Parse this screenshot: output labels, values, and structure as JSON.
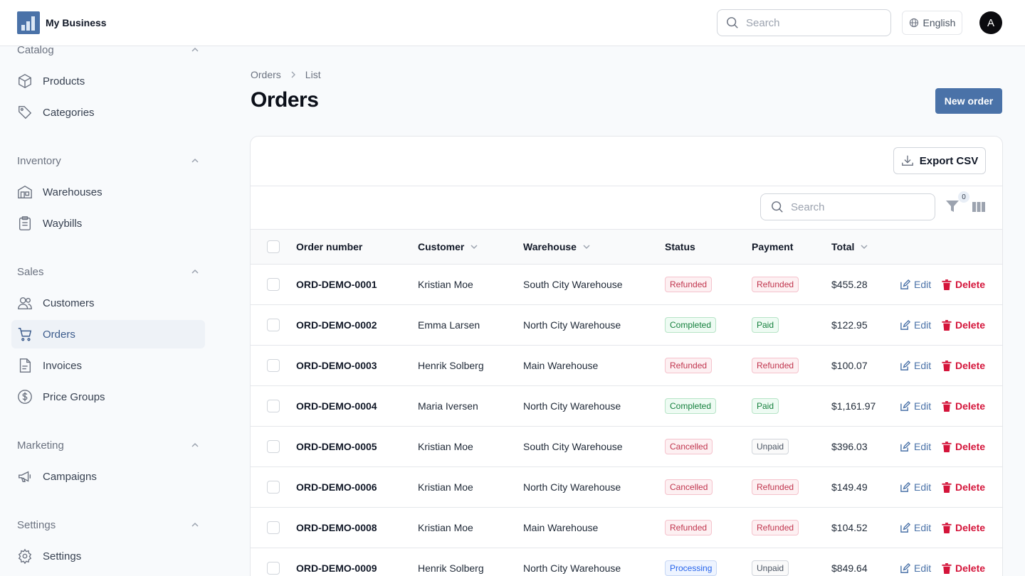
{
  "header": {
    "brand_name": "My Business",
    "search_placeholder": "Search",
    "language": "English",
    "avatar_initial": "A"
  },
  "sidebar": {
    "sections": [
      {
        "title": "Catalog",
        "items": [
          {
            "label": "Products",
            "icon": "box-icon"
          },
          {
            "label": "Categories",
            "icon": "tag-icon"
          }
        ]
      },
      {
        "title": "Inventory",
        "items": [
          {
            "label": "Warehouses",
            "icon": "warehouse-icon"
          },
          {
            "label": "Waybills",
            "icon": "clipboard-icon"
          }
        ]
      },
      {
        "title": "Sales",
        "items": [
          {
            "label": "Customers",
            "icon": "users-icon"
          },
          {
            "label": "Orders",
            "icon": "cart-icon"
          },
          {
            "label": "Invoices",
            "icon": "document-icon"
          },
          {
            "label": "Price Groups",
            "icon": "dollar-circle-icon"
          }
        ]
      },
      {
        "title": "Marketing",
        "items": [
          {
            "label": "Campaigns",
            "icon": "megaphone-icon"
          }
        ]
      },
      {
        "title": "Settings",
        "items": [
          {
            "label": "Settings",
            "icon": "gear-icon"
          }
        ]
      }
    ],
    "active_item": "Orders"
  },
  "breadcrumb": {
    "root": "Orders",
    "current": "List"
  },
  "page": {
    "title": "Orders",
    "new_button": "New order"
  },
  "toolbar": {
    "export_label": "Export CSV",
    "search_placeholder": "Search",
    "filter_count": "0"
  },
  "table": {
    "columns": {
      "order_number": "Order number",
      "customer": "Customer",
      "warehouse": "Warehouse",
      "status": "Status",
      "payment": "Payment",
      "total": "Total"
    },
    "actions": {
      "edit": "Edit",
      "delete": "Delete"
    },
    "rows": [
      {
        "number": "ORD-DEMO-0001",
        "customer": "Kristian Moe",
        "warehouse": "South City Warehouse",
        "status": "Refunded",
        "status_tone": "red",
        "payment": "Refunded",
        "payment_tone": "red",
        "total": "$455.28"
      },
      {
        "number": "ORD-DEMO-0002",
        "customer": "Emma Larsen",
        "warehouse": "North City Warehouse",
        "status": "Completed",
        "status_tone": "green",
        "payment": "Paid",
        "payment_tone": "green",
        "total": "$122.95"
      },
      {
        "number": "ORD-DEMO-0003",
        "customer": "Henrik Solberg",
        "warehouse": "Main Warehouse",
        "status": "Refunded",
        "status_tone": "red",
        "payment": "Refunded",
        "payment_tone": "red",
        "total": "$100.07"
      },
      {
        "number": "ORD-DEMO-0004",
        "customer": "Maria Iversen",
        "warehouse": "North City Warehouse",
        "status": "Completed",
        "status_tone": "green",
        "payment": "Paid",
        "payment_tone": "green",
        "total": "$1,161.97"
      },
      {
        "number": "ORD-DEMO-0005",
        "customer": "Kristian Moe",
        "warehouse": "South City Warehouse",
        "status": "Cancelled",
        "status_tone": "red",
        "payment": "Unpaid",
        "payment_tone": "gray",
        "total": "$396.03"
      },
      {
        "number": "ORD-DEMO-0006",
        "customer": "Kristian Moe",
        "warehouse": "North City Warehouse",
        "status": "Cancelled",
        "status_tone": "red",
        "payment": "Refunded",
        "payment_tone": "red",
        "total": "$149.49"
      },
      {
        "number": "ORD-DEMO-0008",
        "customer": "Kristian Moe",
        "warehouse": "Main Warehouse",
        "status": "Refunded",
        "status_tone": "red",
        "payment": "Refunded",
        "payment_tone": "red",
        "total": "$104.52"
      },
      {
        "number": "ORD-DEMO-0009",
        "customer": "Henrik Solberg",
        "warehouse": "North City Warehouse",
        "status": "Processing",
        "status_tone": "blue",
        "payment": "Unpaid",
        "payment_tone": "gray",
        "total": "$849.64"
      }
    ]
  },
  "colors": {
    "accent": "#4a72a8",
    "danger": "#d4143a",
    "active_bg": "#eef2f7"
  }
}
